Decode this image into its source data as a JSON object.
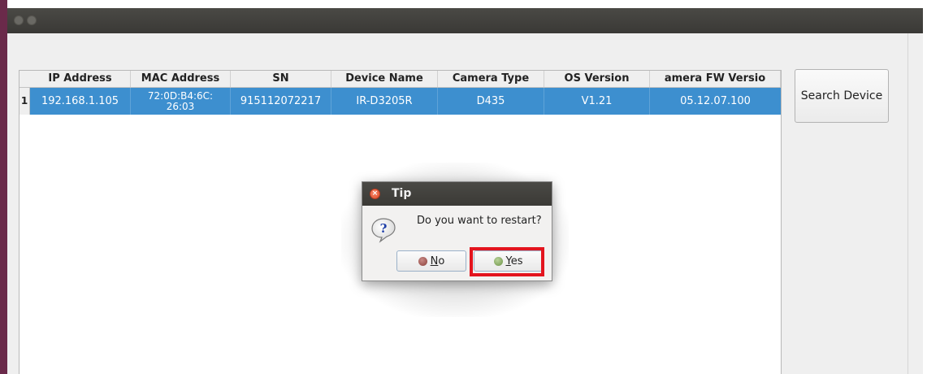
{
  "table": {
    "headers": [
      "IP Address",
      "MAC Address",
      "SN",
      "Device Name",
      "Camera Type",
      "OS Version",
      "amera FW Versio"
    ],
    "rows": [
      {
        "index": "1",
        "ip": "192.168.1.105",
        "mac_line1": "72:0D:B4:6C:",
        "mac_line2": "26:03",
        "sn": "915112072217",
        "device_name": "IR-D3205R",
        "camera_type": "D435",
        "os_version": "V1.21",
        "fw_version": "05.12.07.100"
      }
    ]
  },
  "search_button": {
    "label": "Search Device"
  },
  "dialog": {
    "title": "Tip",
    "message": "Do you want to restart?",
    "no_label": "No",
    "yes_label": "Yes"
  },
  "colors": {
    "selection": "#3d8fcf",
    "titlebar": "#3f3e3a",
    "highlight": "#e3141e"
  }
}
